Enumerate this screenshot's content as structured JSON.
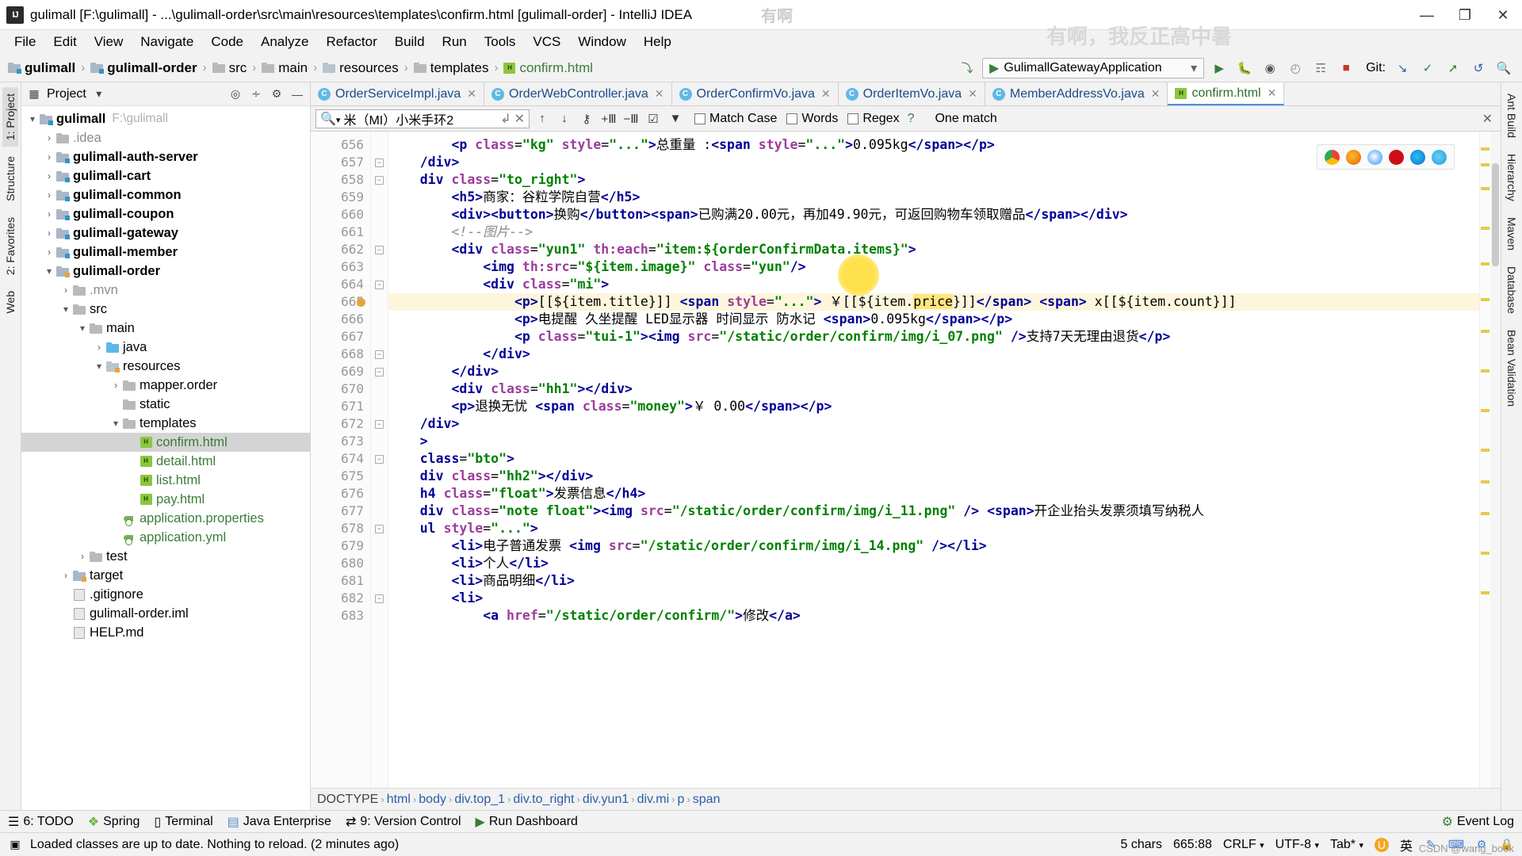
{
  "window": {
    "title": "gulimall [F:\\gulimall] - ...\\gulimall-order\\src\\main\\resources\\templates\\confirm.html [gulimall-order] - IntelliJ IDEA",
    "minimize": "—",
    "maximize": "❐",
    "close": "✕"
  },
  "menu": [
    "File",
    "Edit",
    "View",
    "Navigate",
    "Code",
    "Analyze",
    "Refactor",
    "Build",
    "Run",
    "Tools",
    "VCS",
    "Window",
    "Help"
  ],
  "navbar": {
    "crumbs": [
      "gulimall",
      "gulimall-order",
      "src",
      "main",
      "resources",
      "templates",
      "confirm.html"
    ],
    "run_config": "GulimallGatewayApplication",
    "git_label": "Git:"
  },
  "project": {
    "panel_title": "Project",
    "tree": [
      {
        "indent": 0,
        "arrow": "v",
        "icon": "module",
        "label": "gulimall",
        "bold": true,
        "path": "F:\\gulimall"
      },
      {
        "indent": 1,
        "arrow": ">",
        "icon": "grey-folder",
        "label": ".idea",
        "bold": false,
        "grey": true
      },
      {
        "indent": 1,
        "arrow": ">",
        "icon": "module",
        "label": "gulimall-auth-server",
        "bold": true
      },
      {
        "indent": 1,
        "arrow": ">",
        "icon": "module",
        "label": "gulimall-cart",
        "bold": true
      },
      {
        "indent": 1,
        "arrow": ">",
        "icon": "module",
        "label": "gulimall-common",
        "bold": true
      },
      {
        "indent": 1,
        "arrow": ">",
        "icon": "module",
        "label": "gulimall-coupon",
        "bold": true
      },
      {
        "indent": 1,
        "arrow": ">",
        "icon": "module",
        "label": "gulimall-gateway",
        "bold": true
      },
      {
        "indent": 1,
        "arrow": ">",
        "icon": "module",
        "label": "gulimall-member",
        "bold": true
      },
      {
        "indent": 1,
        "arrow": "v",
        "icon": "module-orange",
        "label": "gulimall-order",
        "bold": true
      },
      {
        "indent": 2,
        "arrow": ">",
        "icon": "grey-folder",
        "label": ".mvn",
        "bold": false,
        "grey": true
      },
      {
        "indent": 2,
        "arrow": "v",
        "icon": "grey-folder",
        "label": "src",
        "bold": false
      },
      {
        "indent": 3,
        "arrow": "v",
        "icon": "grey-folder",
        "label": "main",
        "bold": false
      },
      {
        "indent": 4,
        "arrow": ">",
        "icon": "blue-folder",
        "label": "java",
        "bold": false
      },
      {
        "indent": 4,
        "arrow": "v",
        "icon": "res-folder",
        "label": "resources",
        "bold": false
      },
      {
        "indent": 5,
        "arrow": ">",
        "icon": "pkg-folder",
        "label": "mapper.order",
        "bold": false
      },
      {
        "indent": 5,
        "arrow": "",
        "icon": "pkg-folder",
        "label": "static",
        "bold": false
      },
      {
        "indent": 5,
        "arrow": "v",
        "icon": "pkg-folder",
        "label": "templates",
        "bold": false
      },
      {
        "indent": 6,
        "arrow": "",
        "icon": "html",
        "label": "confirm.html",
        "green": true,
        "selected": true
      },
      {
        "indent": 6,
        "arrow": "",
        "icon": "html",
        "label": "detail.html",
        "green": true
      },
      {
        "indent": 6,
        "arrow": "",
        "icon": "html",
        "label": "list.html",
        "green": true
      },
      {
        "indent": 6,
        "arrow": "",
        "icon": "html",
        "label": "pay.html",
        "green": true
      },
      {
        "indent": 5,
        "arrow": "",
        "icon": "properties",
        "label": "application.properties",
        "green": true
      },
      {
        "indent": 5,
        "arrow": "",
        "icon": "properties",
        "label": "application.yml",
        "green": true
      },
      {
        "indent": 3,
        "arrow": ">",
        "icon": "grey-folder",
        "label": "test",
        "bold": false
      },
      {
        "indent": 2,
        "arrow": ">",
        "icon": "target-folder",
        "label": "target",
        "bold": false
      },
      {
        "indent": 2,
        "arrow": "",
        "icon": "file",
        "label": ".gitignore",
        "bold": false
      },
      {
        "indent": 2,
        "arrow": "",
        "icon": "file",
        "label": "gulimall-order.iml",
        "bold": false
      },
      {
        "indent": 2,
        "arrow": "",
        "icon": "file",
        "label": "HELP.md",
        "bold": false
      }
    ]
  },
  "left_strip": [
    "1: Project",
    "2: Favorites",
    "Web",
    "Structure"
  ],
  "right_strip": [
    "Ant Build",
    "Hierarchy",
    "Maven",
    "Database",
    "Bean Validation"
  ],
  "editor": {
    "tabs": [
      {
        "label": "OrderServiceImpl.java",
        "icon": "class",
        "active": false
      },
      {
        "label": "OrderWebController.java",
        "icon": "class",
        "active": false
      },
      {
        "label": "OrderConfirmVo.java",
        "icon": "class",
        "active": false
      },
      {
        "label": "OrderItemVo.java",
        "icon": "class",
        "active": false
      },
      {
        "label": "MemberAddressVo.java",
        "icon": "class",
        "active": false
      },
      {
        "label": "confirm.html",
        "icon": "html",
        "active": true
      }
    ],
    "find": {
      "query": "米（MI）小米手环2",
      "match_case": "Match Case",
      "words": "Words",
      "regex": "Regex",
      "help": "?",
      "result": "One match"
    },
    "first_line": 656,
    "lines": [
      {
        "n": 656,
        "fold": "",
        "hl": false,
        "html": "        <span class=\"tag\">&lt;p</span> <span class=\"attr\">class</span>=<span class=\"str\">\"kg\"</span> <span class=\"attr\">style</span>=<span class=\"str\">\"...\"</span><span class=\"tag\">&gt;</span><span class=\"txtc\">总重量 :</span><span class=\"tag\">&lt;span</span> <span class=\"attr\">style</span>=<span class=\"str\">\"...\"</span><span class=\"tag\">&gt;</span><span class=\"txtc\">0.095kg</span><span class=\"tag\">&lt;/span&gt;&lt;/p&gt;</span>"
      },
      {
        "n": 657,
        "fold": "-",
        "hl": false,
        "html": "<span class=\"tag\">    /div&gt;</span>"
      },
      {
        "n": 658,
        "fold": "-",
        "hl": false,
        "html": "<span class=\"tag\">    div</span> <span class=\"attr\">class</span>=<span class=\"str\">\"to_right\"</span><span class=\"tag\">&gt;</span>"
      },
      {
        "n": 659,
        "fold": "",
        "hl": false,
        "html": "        <span class=\"tag\">&lt;h5&gt;</span><span class=\"txtc\">商家：谷粒学院自营</span><span class=\"tag\">&lt;/h5&gt;</span>"
      },
      {
        "n": 660,
        "fold": "",
        "hl": false,
        "html": "        <span class=\"tag\">&lt;div&gt;&lt;button&gt;</span><span class=\"txtc\">换购</span><span class=\"tag\">&lt;/button&gt;&lt;span&gt;</span><span class=\"txtc\">已购满20.00元，再加49.90元，可返回购物车领取赠品</span><span class=\"tag\">&lt;/span&gt;&lt;/div&gt;</span>"
      },
      {
        "n": 661,
        "fold": "",
        "hl": false,
        "html": "        <span class=\"cmt\">&lt;!--图片--&gt;</span>"
      },
      {
        "n": 662,
        "fold": "-",
        "hl": false,
        "html": "        <span class=\"tag\">&lt;div</span> <span class=\"attr\">class</span>=<span class=\"str\">\"yun1\"</span> <span class=\"attr\">th:each</span>=<span class=\"str\">\"item:${orderConfirmData.items}\"</span><span class=\"tag\">&gt;</span>"
      },
      {
        "n": 663,
        "fold": "",
        "hl": false,
        "html": "            <span class=\"tag\">&lt;img</span> <span class=\"attr\">th:src</span>=<span class=\"str\">\"${item.image}\"</span> <span class=\"attr\">class</span>=<span class=\"str\">\"yun\"</span><span class=\"tag\">/&gt;</span>"
      },
      {
        "n": 664,
        "fold": "-",
        "hl": false,
        "html": "            <span class=\"tag\">&lt;div</span> <span class=\"attr\">class</span>=<span class=\"str\">\"mi\"</span><span class=\"tag\">&gt;</span>"
      },
      {
        "n": 665,
        "fold": "",
        "hl": true,
        "html": "                <span class=\"tag\">&lt;p&gt;</span><span class=\"txtc\">[[${item.title}]]</span> <span class=\"tag\">&lt;span</span> <span class=\"attr\">style</span>=<span class=\"str\">\"...\"</span><span class=\"tag\">&gt;</span> <span class=\"txtc\">￥[[${item.</span><span class=\"sel-yellow\">price</span><span class=\"txtc\">}]]</span><span class=\"tag\">&lt;/span&gt;</span> <span class=\"tag\">&lt;span&gt;</span> <span class=\"txtc\">x[[${item.count}]]</span>"
      },
      {
        "n": 666,
        "fold": "",
        "hl": false,
        "html": "                <span class=\"tag\">&lt;p&gt;</span><span class=\"txtc\">电提醒 久坐提醒 LED显示器 时间显示 防水记</span> <span class=\"tag\">&lt;span&gt;</span><span class=\"txtc\">0.095kg</span><span class=\"tag\">&lt;/span&gt;&lt;/p&gt;</span>"
      },
      {
        "n": 667,
        "fold": "",
        "hl": false,
        "html": "                <span class=\"tag\">&lt;p</span> <span class=\"attr\">class</span>=<span class=\"str\">\"tui-1\"</span><span class=\"tag\">&gt;&lt;img</span> <span class=\"attr\">src</span>=<span class=\"str\">\"/static/order/confirm/img/i_07.png\"</span> <span class=\"tag\">/&gt;</span><span class=\"txtc\">支持7天无理由退货</span><span class=\"tag\">&lt;/p&gt;</span>"
      },
      {
        "n": 668,
        "fold": "-",
        "hl": false,
        "html": "            <span class=\"tag\">&lt;/div&gt;</span>"
      },
      {
        "n": 669,
        "fold": "-",
        "hl": false,
        "html": "        <span class=\"tag\">&lt;/div&gt;</span>"
      },
      {
        "n": 670,
        "fold": "",
        "hl": false,
        "html": "        <span class=\"tag\">&lt;div</span> <span class=\"attr\">class</span>=<span class=\"str\">\"hh1\"</span><span class=\"tag\">&gt;&lt;/div&gt;</span>"
      },
      {
        "n": 671,
        "fold": "",
        "hl": false,
        "html": "        <span class=\"tag\">&lt;p&gt;</span><span class=\"txtc\">退换无忧</span> <span class=\"tag\">&lt;span</span> <span class=\"attr\">class</span>=<span class=\"str\">\"money\"</span><span class=\"tag\">&gt;</span><span class=\"txtc\">￥ 0.00</span><span class=\"tag\">&lt;/span&gt;&lt;/p&gt;</span>"
      },
      {
        "n": 672,
        "fold": "-",
        "hl": false,
        "html": "<span class=\"tag\">    /div&gt;</span>"
      },
      {
        "n": 673,
        "fold": "",
        "hl": false,
        "html": "<span class=\"tag\">    &gt;</span>"
      },
      {
        "n": 674,
        "fold": "-",
        "hl": false,
        "html": "<span class=\"tag\">    class</span>=<span class=\"str\">\"bto\"</span><span class=\"tag\">&gt;</span>"
      },
      {
        "n": 675,
        "fold": "",
        "hl": false,
        "html": "    <span class=\"tag\">div</span> <span class=\"attr\">class</span>=<span class=\"str\">\"hh2\"</span><span class=\"tag\">&gt;&lt;/div&gt;</span>"
      },
      {
        "n": 676,
        "fold": "",
        "hl": false,
        "html": "    <span class=\"tag\">h4</span> <span class=\"attr\">class</span>=<span class=\"str\">\"float\"</span><span class=\"tag\">&gt;</span><span class=\"txtc\">发票信息</span><span class=\"tag\">&lt;/h4&gt;</span>"
      },
      {
        "n": 677,
        "fold": "",
        "hl": false,
        "html": "    <span class=\"tag\">div</span> <span class=\"attr\">class</span>=<span class=\"str\">\"note float\"</span><span class=\"tag\">&gt;&lt;img</span> <span class=\"attr\">src</span>=<span class=\"str\">\"/static/order/confirm/img/i_11.png\"</span> <span class=\"tag\">/&gt;</span> <span class=\"tag\">&lt;span&gt;</span><span class=\"txtc\">开企业抬头发票须填写纳税人</span>"
      },
      {
        "n": 678,
        "fold": "-",
        "hl": false,
        "html": "    <span class=\"tag\">ul</span> <span class=\"attr\">style</span>=<span class=\"str\">\"...\"</span><span class=\"tag\">&gt;</span>"
      },
      {
        "n": 679,
        "fold": "",
        "hl": false,
        "html": "        <span class=\"tag\">&lt;li&gt;</span><span class=\"txtc\">电子普通发票</span> <span class=\"tag\">&lt;img</span> <span class=\"attr\">src</span>=<span class=\"str\">\"/static/order/confirm/img/i_14.png\"</span> <span class=\"tag\">/&gt;&lt;/li&gt;</span>"
      },
      {
        "n": 680,
        "fold": "",
        "hl": false,
        "html": "        <span class=\"tag\">&lt;li&gt;</span><span class=\"txtc\">个人</span><span class=\"tag\">&lt;/li&gt;</span>"
      },
      {
        "n": 681,
        "fold": "",
        "hl": false,
        "html": "        <span class=\"tag\">&lt;li&gt;</span><span class=\"txtc\">商品明细</span><span class=\"tag\">&lt;/li&gt;</span>"
      },
      {
        "n": 682,
        "fold": "-",
        "hl": false,
        "html": "        <span class=\"tag\">&lt;li&gt;</span>"
      },
      {
        "n": 683,
        "fold": "",
        "hl": false,
        "html": "            <span class=\"tag\">&lt;a</span> <span class=\"attr\">href</span>=<span class=\"str\">\"/static/order/confirm/\"</span><span class=\"tag\">&gt;</span><span class=\"txtc\">修改</span><span class=\"tag\">&lt;/a&gt;</span>"
      }
    ],
    "breadcrumb": [
      "DOCTYPE",
      "html",
      "body",
      "div.top_1",
      "div.to_right",
      "div.yun1",
      "div.mi",
      "p",
      "span"
    ]
  },
  "toolwindows": {
    "left": [
      {
        "key": "6",
        "label": "6: TODO"
      },
      {
        "key": "",
        "label": "Spring"
      },
      {
        "key": "",
        "label": "Terminal"
      },
      {
        "key": "",
        "label": "Java Enterprise"
      },
      {
        "key": "9",
        "label": "9: Version Control"
      },
      {
        "key": "",
        "label": "Run Dashboard"
      }
    ],
    "right": "Event Log"
  },
  "status": {
    "message": "Loaded classes are up to date. Nothing to reload. (2 minutes ago)",
    "chars": "5 chars",
    "position": "665:88",
    "line_sep": "CRLF",
    "encoding": "UTF-8",
    "indent": "Tab*",
    "ime": "英"
  },
  "watermarks": {
    "top": "有啊",
    "right1": "有啊，我反正高中暑",
    "csdn": "CSDN @wang_book"
  },
  "colors": {
    "accent": "#4a90d9",
    "tag": "#000096",
    "string": "#008000",
    "attr": "#9b3d9b",
    "comment": "#8c8c8c",
    "highlight": "#ffe57f"
  }
}
